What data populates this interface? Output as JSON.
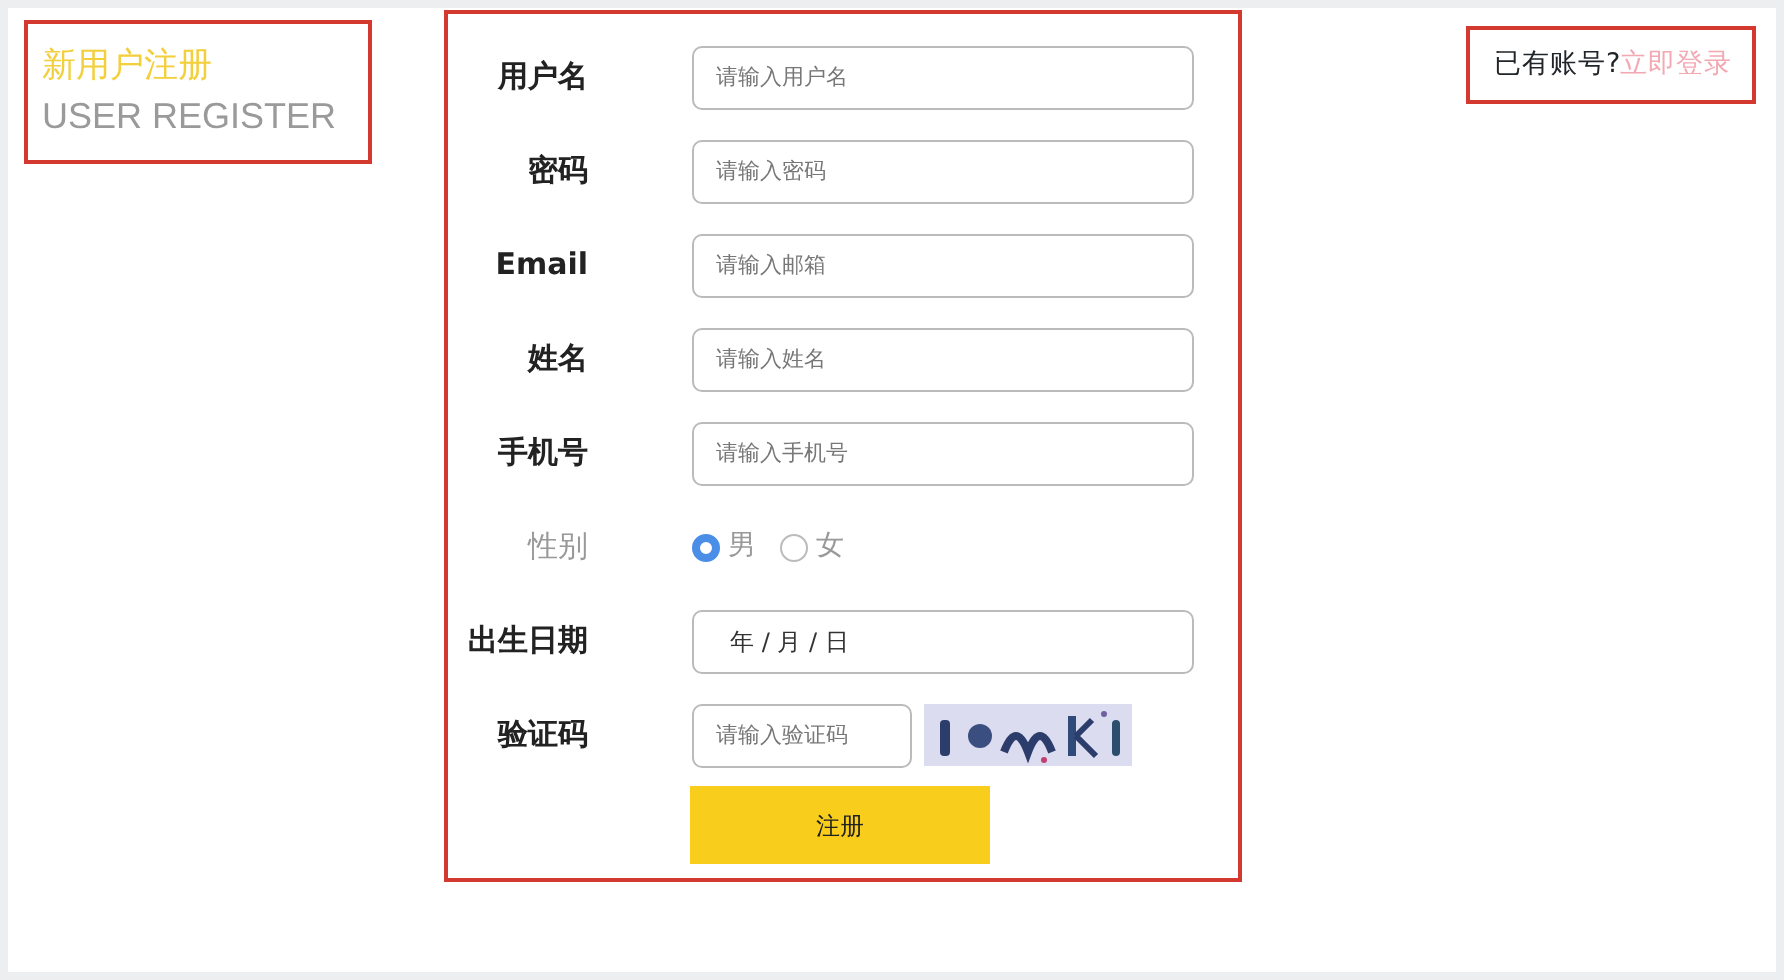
{
  "header": {
    "title": "新用户注册",
    "subtitle": "USER REGISTER"
  },
  "login_prompt": {
    "text": "已有账号?",
    "link": "立即登录"
  },
  "fields": [
    {
      "kind": "text",
      "label": "用户名",
      "placeholder": "请输入用户名"
    },
    {
      "kind": "text",
      "label": "密码",
      "placeholder": "请输入密码"
    },
    {
      "kind": "text",
      "label": "Email",
      "placeholder": "请输入邮箱"
    },
    {
      "kind": "text",
      "label": "姓名",
      "placeholder": "请输入姓名"
    },
    {
      "kind": "text",
      "label": "手机号",
      "placeholder": "请输入手机号"
    },
    {
      "kind": "radio",
      "label": "性别",
      "options": [
        {
          "label": "男",
          "selected": true
        },
        {
          "label": "女",
          "selected": false
        }
      ]
    },
    {
      "kind": "date",
      "label": "出生日期",
      "value": "年  / 月 / 日"
    },
    {
      "kind": "captcha",
      "label": "验证码",
      "placeholder": "请输入验证码"
    }
  ],
  "submit": "注册"
}
